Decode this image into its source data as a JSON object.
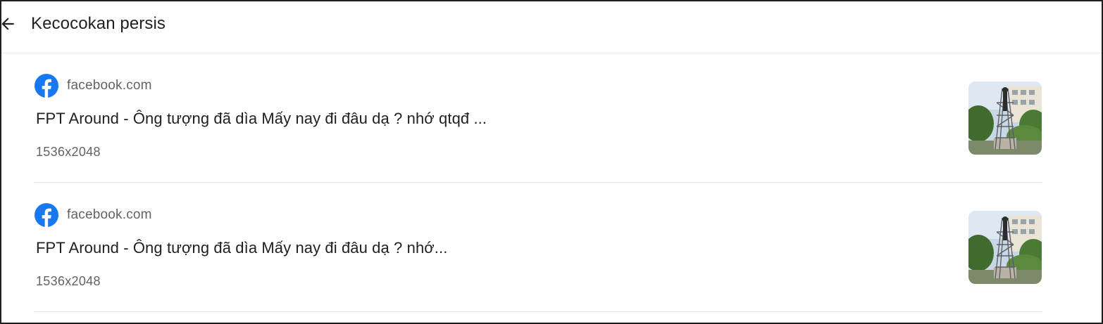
{
  "header": {
    "back_icon": "arrow-left-icon",
    "title": "Kecocokan persis"
  },
  "results": [
    {
      "source_icon": "facebook-icon",
      "source": "facebook.com",
      "title": "FPT Around - Ông tượng đã dìa Mấy nay đi đâu dạ ? nhớ qtqđ ...",
      "dimensions": "1536x2048",
      "thumbnail": "statue-scaffolding-photo"
    },
    {
      "source_icon": "facebook-icon",
      "source": "facebook.com",
      "title": "FPT Around - Ông tượng đã dìa Mấy nay đi đâu dạ ? nhớ...",
      "dimensions": "1536x2048",
      "thumbnail": "statue-scaffolding-photo"
    }
  ],
  "colors": {
    "facebook_blue": "#1877f2",
    "text_primary": "#202124",
    "text_secondary": "#5f6368",
    "divider": "#e3e3e3"
  }
}
